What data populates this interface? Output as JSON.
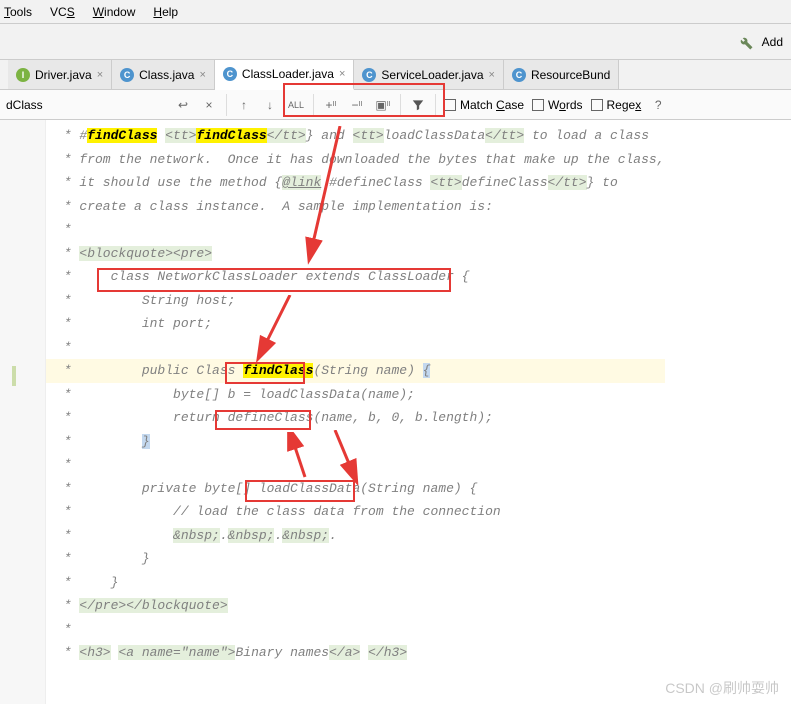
{
  "menu": {
    "items": [
      "Tools",
      "VCS",
      "Window",
      "Help"
    ]
  },
  "toolbar": {
    "addLabel": "Add"
  },
  "tabs": [
    {
      "icon": "I",
      "iconClass": "i",
      "label": "Driver.java"
    },
    {
      "icon": "C",
      "iconClass": "c",
      "label": "Class.java"
    },
    {
      "icon": "C",
      "iconClass": "c",
      "label": "ClassLoader.java",
      "active": true
    },
    {
      "icon": "C",
      "iconClass": "c",
      "label": "ServiceLoader.java"
    },
    {
      "icon": "C",
      "iconClass": "c",
      "label": "ResourceBund"
    }
  ],
  "find": {
    "query": "dClass",
    "matchCase": "Match Case",
    "words": "Words",
    "regex": "Regex",
    "help": "?"
  },
  "code": {
    "l1_a": " * #",
    "l1_b": "findClass",
    "l1_c": " ",
    "l1_d": "<tt>",
    "l1_e": "findClass",
    "l1_f": "</tt>",
    "l1_g": "} and ",
    "l1_h": "<tt>",
    "l1_i": "loadClassData",
    "l1_j": "</tt>",
    "l1_k": " to load a class",
    "l2": " * from the network.  Once it has downloaded the bytes that make up the class,",
    "l3_a": " * it should use the method {",
    "l3_b": "@link",
    "l3_c": " #defineClass ",
    "l3_d": "<tt>",
    "l3_e": "defineClass",
    "l3_f": "</tt>",
    "l3_g": "} to",
    "l4": " * create a class instance.  A sample implementation is:",
    "l5": " *",
    "l6_a": " * ",
    "l6_b": "<blockquote><pre>",
    "l7": " *     class NetworkClassLoader extends ClassLoader {",
    "l8": " *         String host;",
    "l9": " *         int port;",
    "l10": " *",
    "l11_a": " *         public Class ",
    "l11_b": "findClass",
    "l11_c": "(String name) ",
    "l11_d": "{",
    "l12": " *             byte[] b = loadClassData(name);",
    "l13": " *             return defineClass(name, b, 0, b.length);",
    "l14_a": " *         ",
    "l14_b": "}",
    "l15": " *",
    "l16": " *         private byte[] loadClassData(String name) {",
    "l17": " *             // load the class data from the connection",
    "l18_a": " *             ",
    "l18_b": "&nbsp;",
    "l18_c": ".",
    "l18_d": "&nbsp;",
    "l18_e": ".",
    "l18_f": "&nbsp;",
    "l18_g": ".",
    "l19": " *         }",
    "l20": " *     }",
    "l21_a": " * ",
    "l21_b": "</pre></blockquote>",
    "l22": " *",
    "l23_a": " * ",
    "l23_b": "<h3>",
    "l23_c": " ",
    "l23_d": "<a name=\"name\">",
    "l23_e": "Binary names",
    "l23_f": "</a>",
    "l23_g": " ",
    "l23_h": "</h3>"
  },
  "watermark": "CSDN @刷帅耍帅"
}
